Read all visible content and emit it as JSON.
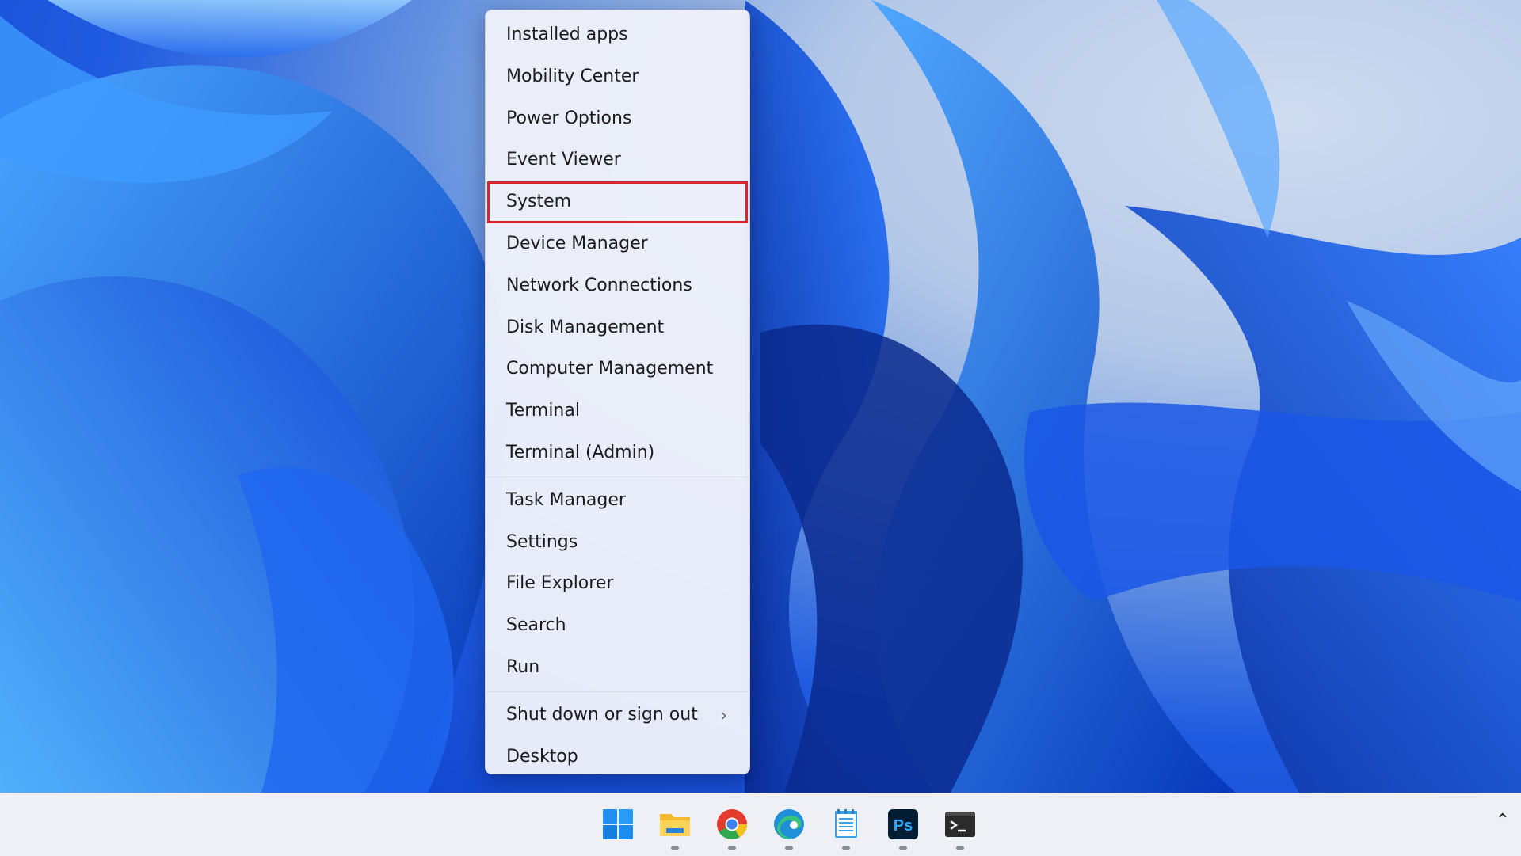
{
  "menu": {
    "items_group1": [
      {
        "label": "Installed apps"
      },
      {
        "label": "Mobility Center"
      },
      {
        "label": "Power Options"
      },
      {
        "label": "Event Viewer"
      },
      {
        "label": "System",
        "highlighted": true
      },
      {
        "label": "Device Manager"
      },
      {
        "label": "Network Connections"
      },
      {
        "label": "Disk Management"
      },
      {
        "label": "Computer Management"
      },
      {
        "label": "Terminal"
      },
      {
        "label": "Terminal (Admin)"
      }
    ],
    "items_group2": [
      {
        "label": "Task Manager"
      },
      {
        "label": "Settings"
      },
      {
        "label": "File Explorer"
      },
      {
        "label": "Search"
      },
      {
        "label": "Run"
      }
    ],
    "items_group3": [
      {
        "label": "Shut down or sign out",
        "submenu_icon": "chevron-right-icon"
      },
      {
        "label": "Desktop"
      }
    ],
    "highlight_color": "#d7262e"
  },
  "taskbar": {
    "icons": [
      {
        "name": "windows-start-icon"
      },
      {
        "name": "file-explorer-icon"
      },
      {
        "name": "chrome-icon"
      },
      {
        "name": "edge-icon"
      },
      {
        "name": "notepad-icon"
      },
      {
        "name": "photoshop-icon",
        "text": "Ps"
      },
      {
        "name": "terminal-icon"
      }
    ],
    "tray_icon": "chevron-up-icon"
  },
  "colors": {
    "wallpaper_blue": "#1f5be0",
    "taskbar_bg": "#eef0f5",
    "menu_bg": "#eef1fa"
  }
}
